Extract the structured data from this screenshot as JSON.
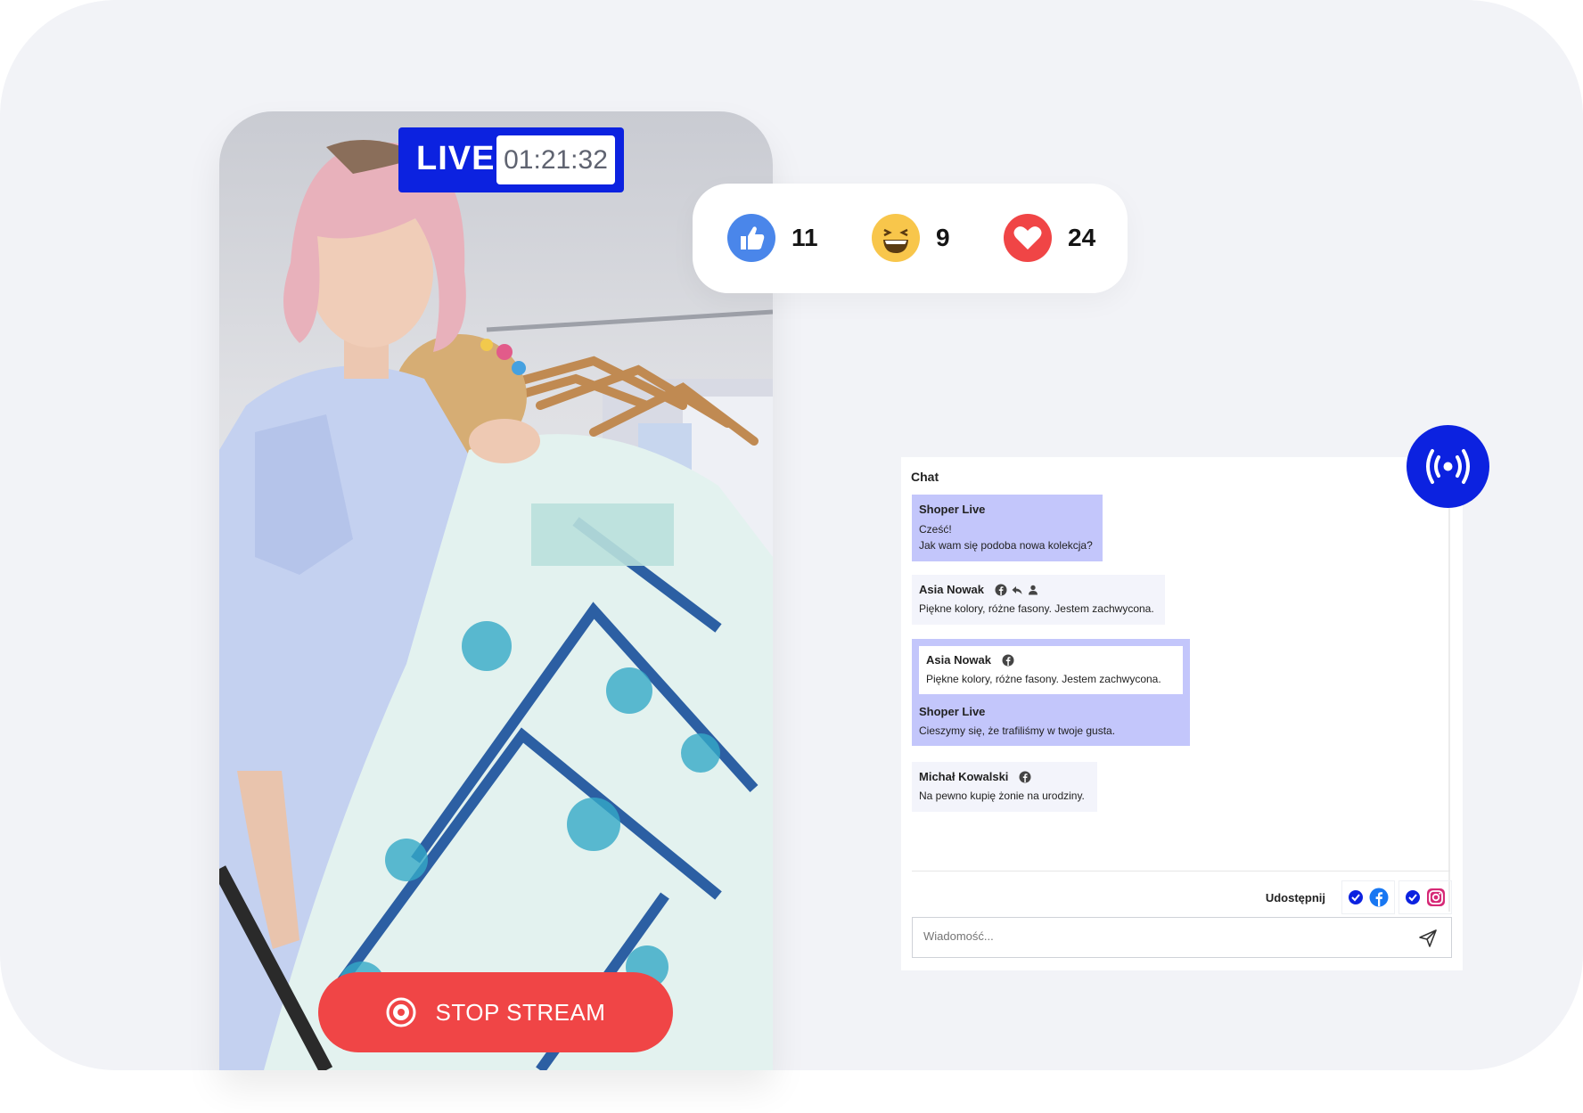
{
  "live": {
    "label": "LIVE",
    "timer": "01:21:32"
  },
  "reactions": [
    {
      "icon": "thumbs-up-icon",
      "count": "11",
      "color": "#4a86ea"
    },
    {
      "icon": "laughing-emoji-icon",
      "count": "9",
      "color": "#f8c64b"
    },
    {
      "icon": "heart-icon",
      "count": "24",
      "color": "#f04546"
    }
  ],
  "stop_button": {
    "label": "STOP STREAM",
    "color": "#f04546"
  },
  "chat": {
    "title": "Chat",
    "messages": [
      {
        "author": "Shoper Live",
        "lines": [
          "Cześć!",
          "Jak wam się podoba nowa kolekcja?"
        ]
      },
      {
        "author": "Asia Nowak",
        "lines": [
          "Piękne kolory, różne fasony. Jestem zachwycona."
        ]
      },
      {
        "quote_author": "Asia Nowak",
        "quote_text": "Piękne kolory, różne fasony. Jestem zachwycona.",
        "author": "Shoper Live",
        "lines": [
          "Cieszymy się, że trafiliśmy w twoje gusta."
        ]
      },
      {
        "author": "Michał Kowalski",
        "lines": [
          "Na pewno kupię żonie na urodziny."
        ]
      }
    ],
    "share_label": "Udostępnij",
    "input_placeholder": "Wiadomość..."
  },
  "colors": {
    "brand_blue": "#0c22e0",
    "own_message_bg": "#c3c6fb",
    "user_message_bg": "#f3f4fb"
  }
}
